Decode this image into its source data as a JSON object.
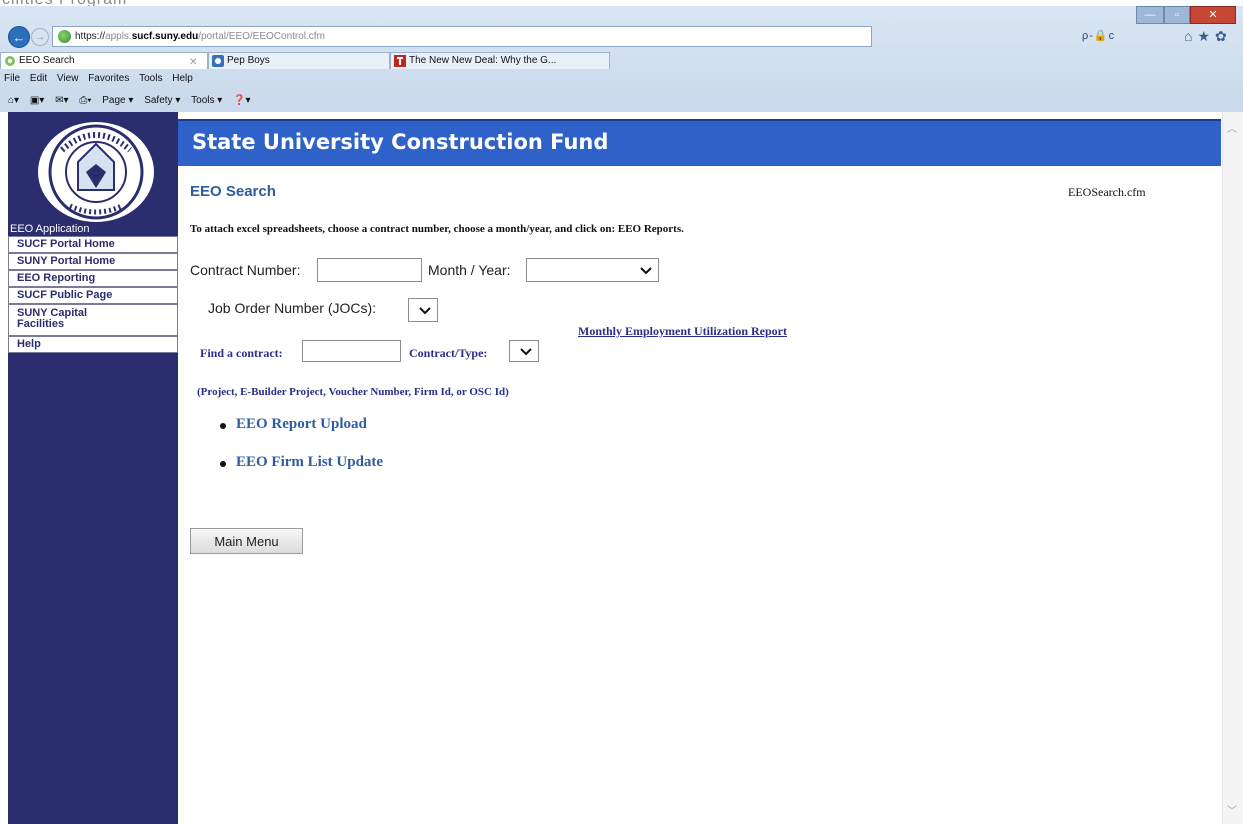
{
  "overlay": {
    "caption": "cilities Program"
  },
  "browser": {
    "address": {
      "scheme": "https://",
      "prefix": "appls.",
      "host": "sucf.suny.edu",
      "path": "/portal/EEO/EEOControl.cfm"
    },
    "address_right": "ρ-🔒c",
    "tabs": [
      {
        "label": "EEO Search",
        "active": true
      },
      {
        "label": "Pep Boys",
        "active": false
      },
      {
        "label": "The New New Deal: Why the G...",
        "active": false
      }
    ],
    "menu": [
      "File",
      "Edit",
      "View",
      "Favorites",
      "Tools",
      "Help"
    ],
    "command_bar": [
      "Page ▾",
      "Safety ▾",
      "Tools ▾"
    ]
  },
  "sidebar": {
    "app_label": "EEO Application",
    "items": [
      {
        "label": "SUCF Portal Home"
      },
      {
        "label": "SUNY Portal Home"
      },
      {
        "label": "EEO Reporting"
      },
      {
        "label": "SUCF Public Page"
      },
      {
        "label": "SUNY Capital\nFacilities"
      },
      {
        "label": "Help"
      }
    ],
    "logo": {
      "ring_text_top": "STATE UNIVERSITY CONSTRUCTION FUND",
      "bottom_text": "NEW YORK"
    }
  },
  "header": {
    "title": "State University Construction Fund"
  },
  "page": {
    "title": "EEO Search",
    "file_name": "EEOSearch.cfm",
    "instructions": "To attach excel spreadsheets, choose a contract number, choose a month/year, and click on: EEO Reports.",
    "contract_number_label": "Contract Number:",
    "contract_number_value": "",
    "month_year_label": "Month / Year:",
    "month_year_value": "",
    "joc_label": "Job Order Number (JOCs):",
    "joc_value": "",
    "utilization_link": "Monthly Employment Utilization Report",
    "find_contract_label": "Find a contract:",
    "find_contract_value": "",
    "contract_type_label": "Contract/Type:",
    "contract_type_value": "",
    "hint": "(Project, E-Builder Project, Voucher Number, Firm Id, or OSC Id)",
    "links": [
      {
        "label": "EEO Report Upload"
      },
      {
        "label": "EEO Firm List Update"
      }
    ],
    "main_menu_button": "Main Menu"
  },
  "colors": {
    "sidebar_bg": "#2b2e6e",
    "banner_bg": "#2e62c8",
    "heading_blue": "#2e5d9f",
    "link_navy": "#2b2e8a"
  }
}
